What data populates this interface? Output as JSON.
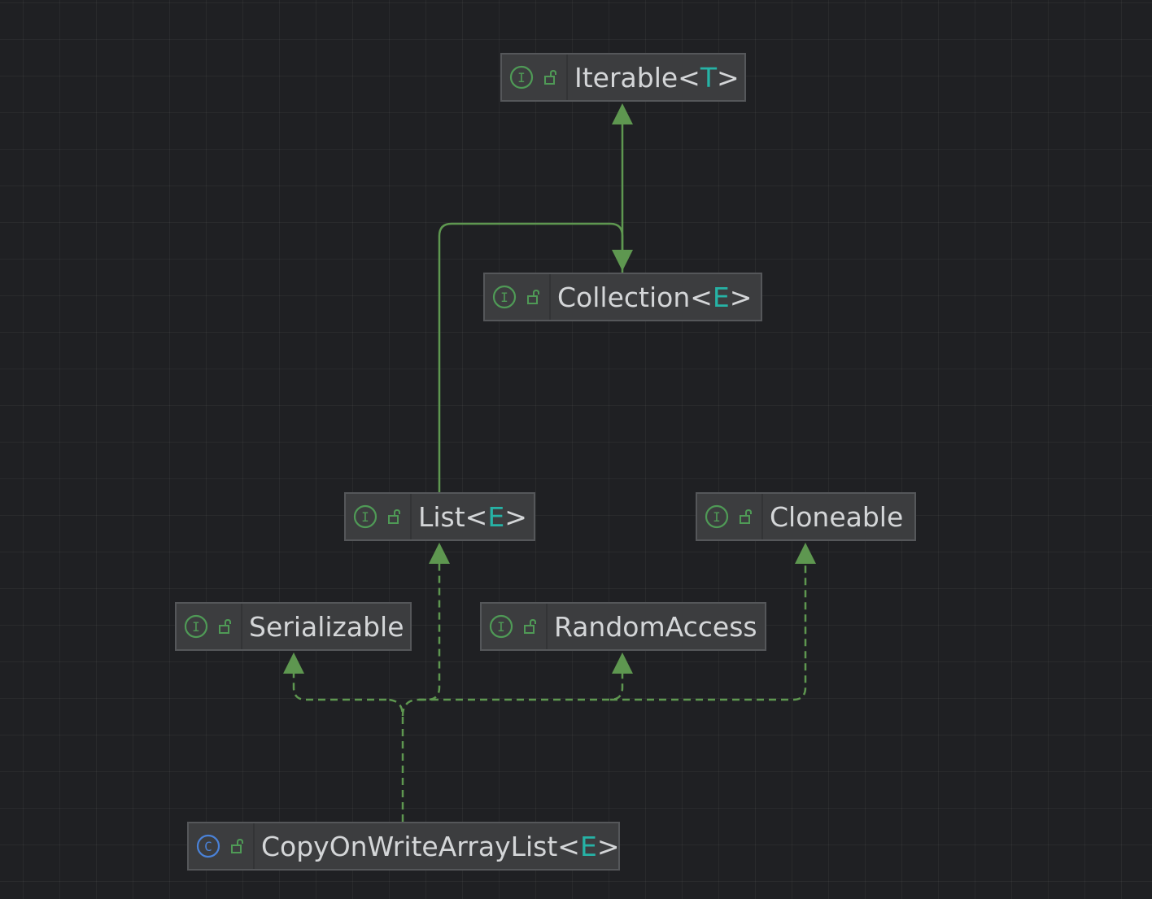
{
  "nodes": {
    "iterable": {
      "kind": "interface",
      "kind_letter": "I",
      "name": "Iterable<",
      "type_param": "T",
      "close": ">"
    },
    "collection": {
      "kind": "interface",
      "kind_letter": "I",
      "name": "Collection<",
      "type_param": "E",
      "close": ">"
    },
    "list": {
      "kind": "interface",
      "kind_letter": "I",
      "name": "List<",
      "type_param": "E",
      "close": ">"
    },
    "cloneable": {
      "kind": "interface",
      "kind_letter": "I",
      "name": "Cloneable",
      "type_param": "",
      "close": ""
    },
    "serializable": {
      "kind": "interface",
      "kind_letter": "I",
      "name": "Serializable",
      "type_param": "",
      "close": ""
    },
    "random_access": {
      "kind": "interface",
      "kind_letter": "I",
      "name": "RandomAccess",
      "type_param": "",
      "close": ""
    },
    "copy_on_write_array_list": {
      "kind": "class",
      "kind_letter": "C",
      "name": "CopyOnWriteArrayList<",
      "type_param": "E",
      "close": ">"
    }
  },
  "edges": [
    {
      "from": "collection",
      "to": "iterable",
      "relation": "extends"
    },
    {
      "from": "list",
      "to": "collection",
      "relation": "extends"
    },
    {
      "from": "copy_on_write_array_list",
      "to": "list",
      "relation": "implements"
    },
    {
      "from": "copy_on_write_array_list",
      "to": "serializable",
      "relation": "implements"
    },
    {
      "from": "copy_on_write_array_list",
      "to": "random_access",
      "relation": "implements"
    },
    {
      "from": "copy_on_write_array_list",
      "to": "cloneable",
      "relation": "implements"
    }
  ],
  "colors": {
    "background": "#1f2023",
    "node_fill": "#3c3d3f",
    "node_border": "#55575a",
    "text": "#d4d6d8",
    "type_param": "#26b3a6",
    "interface_icon": "#4f9a56",
    "class_icon": "#4a82d8",
    "edge": "#5e9750"
  },
  "icons": {
    "interface": "interface-icon",
    "class": "class-icon",
    "visibility": "unlocked-icon"
  }
}
